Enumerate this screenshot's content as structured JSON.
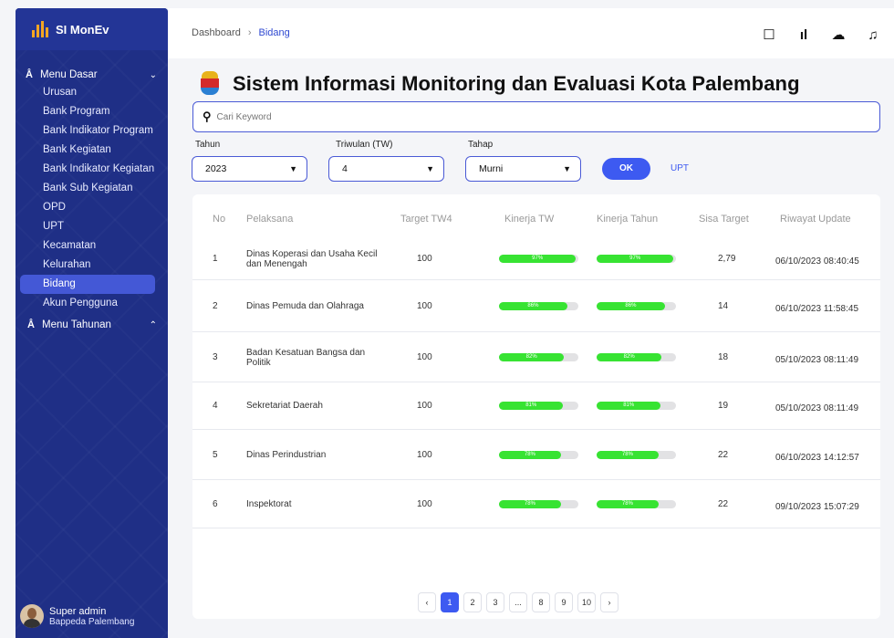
{
  "app": {
    "brand": "SI MonEv",
    "accent": "#3d5af1",
    "sidebar_bg": "#1f2f86"
  },
  "sidebar": {
    "menu_dasar_label": "Menu Dasar",
    "items": [
      "Urusan",
      "Bank Program",
      "Bank Indikator Program",
      "Bank Kegiatan",
      "Bank Indikator Kegiatan",
      "Bank Sub Kegiatan",
      "OPD",
      "UPT",
      "Kecamatan",
      "Kelurahan",
      "Bidang",
      "Akun Pengguna"
    ],
    "active_item": "Bidang",
    "menu_tahunan_label": "Menu Tahunan",
    "user": {
      "name": "Super admin",
      "org": "Bappeda Palembang"
    }
  },
  "header": {
    "breadcrumb": [
      "Dashboard",
      "Bidang"
    ],
    "icons": [
      "message-icon",
      "chart-icon",
      "cloud-upload-icon",
      "bell-icon"
    ]
  },
  "main": {
    "title": "Sistem Informasi Monitoring dan Evaluasi Kota Palembang",
    "search_placeholder": "Cari Keyword",
    "filters": {
      "tahun_label": "Tahun",
      "tahun_value": "2023",
      "triwulan_label": "Triwulan (TW)",
      "triwulan_value": "4",
      "tahap_label": "Tahap",
      "tahap_value": "Murni"
    },
    "ok_label": "OK",
    "upt_label": "UPT",
    "columns": [
      "No",
      "Pelaksana",
      "Target TW4",
      "Kinerja TW",
      "Kinerja Tahun",
      "Sisa Target",
      "Riwayat Update"
    ],
    "rows": [
      {
        "no": "1",
        "pelaksana": "Dinas Koperasi dan Usaha Kecil dan Menengah",
        "target": "100",
        "kinerja_tw": 97,
        "kinerja_tw_label": "97%",
        "kinerja_tahun": 97,
        "kinerja_tahun_label": "97%",
        "sisa": "2,79",
        "update": "06/10/2023 08:40:45"
      },
      {
        "no": "2",
        "pelaksana": "Dinas Pemuda dan Olahraga",
        "target": "100",
        "kinerja_tw": 86,
        "kinerja_tw_label": "86%",
        "kinerja_tahun": 86,
        "kinerja_tahun_label": "86%",
        "sisa": "14",
        "update": "06/10/2023 11:58:45"
      },
      {
        "no": "3",
        "pelaksana": "Badan Kesatuan Bangsa dan Politik",
        "target": "100",
        "kinerja_tw": 82,
        "kinerja_tw_label": "82%",
        "kinerja_tahun": 82,
        "kinerja_tahun_label": "82%",
        "sisa": "18",
        "update": "05/10/2023 08:11:49"
      },
      {
        "no": "4",
        "pelaksana": "Sekretariat Daerah",
        "target": "100",
        "kinerja_tw": 81,
        "kinerja_tw_label": "81%",
        "kinerja_tahun": 81,
        "kinerja_tahun_label": "81%",
        "sisa": "19",
        "update": "05/10/2023 08:11:49"
      },
      {
        "no": "5",
        "pelaksana": "Dinas Perindustrian",
        "target": "100",
        "kinerja_tw": 78,
        "kinerja_tw_label": "78%",
        "kinerja_tahun": 78,
        "kinerja_tahun_label": "78%",
        "sisa": "22",
        "update": "06/10/2023 14:12:57"
      },
      {
        "no": "6",
        "pelaksana": "Inspektorat",
        "target": "100",
        "kinerja_tw": 78,
        "kinerja_tw_label": "78%",
        "kinerja_tahun": 78,
        "kinerja_tahun_label": "78%",
        "sisa": "22",
        "update": "09/10/2023 15:07:29"
      }
    ],
    "pagination": {
      "prev": "‹",
      "pages": [
        "1",
        "2",
        "3",
        "...",
        "8",
        "9",
        "10"
      ],
      "active": "1",
      "next": "›"
    }
  }
}
